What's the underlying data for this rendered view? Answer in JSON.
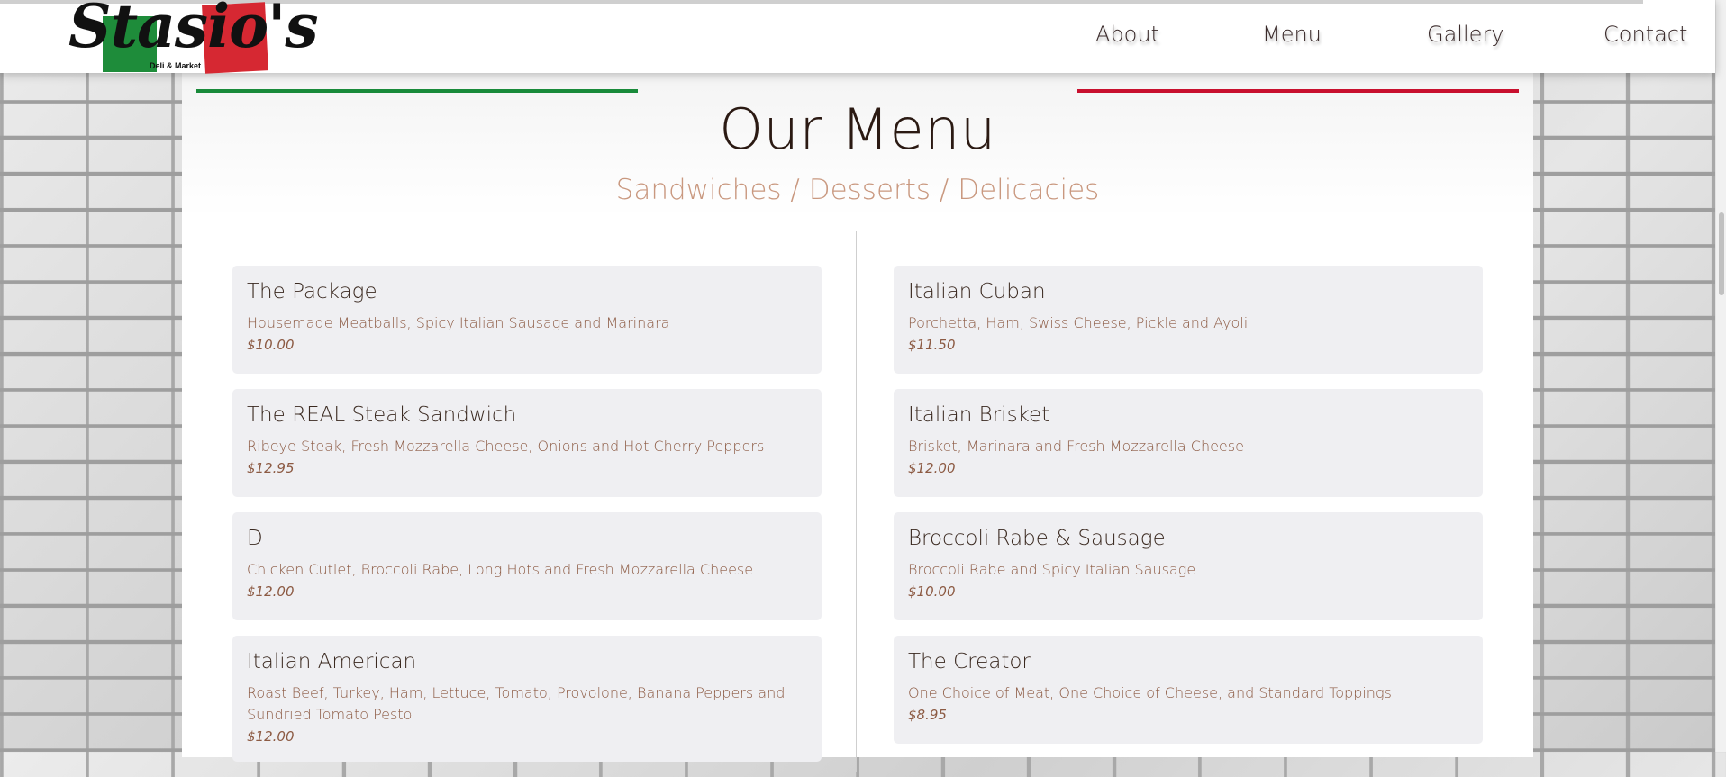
{
  "brand": {
    "logo_text": "Stasio's",
    "logo_subtext": "Deli & Market"
  },
  "nav": {
    "items": [
      "About",
      "Menu",
      "Gallery",
      "Contact"
    ]
  },
  "menu": {
    "title": "Our Menu",
    "subtitle": "Sandwiches / Desserts / Delicacies",
    "left": [
      {
        "name": "The Package",
        "desc": "Housemade Meatballs, Spicy Italian Sausage and Marinara",
        "price": "$10.00"
      },
      {
        "name": "The REAL Steak Sandwich",
        "desc": "Ribeye Steak, Fresh Mozzarella Cheese, Onions and Hot Cherry Peppers",
        "price": "$12.95"
      },
      {
        "name": "D",
        "desc": "Chicken Cutlet, Broccoli Rabe, Long Hots and Fresh Mozzarella Cheese",
        "price": "$12.00"
      },
      {
        "name": "Italian American",
        "desc": "Roast Beef, Turkey, Ham, Lettuce, Tomato, Provolone, Banana Peppers and Sundried Tomato Pesto",
        "price": "$12.00"
      }
    ],
    "right": [
      {
        "name": "Italian Cuban",
        "desc": "Porchetta, Ham, Swiss Cheese, Pickle and Ayoli",
        "price": "$11.50"
      },
      {
        "name": "Italian Brisket",
        "desc": "Brisket, Marinara and Fresh Mozzarella Cheese",
        "price": "$12.00"
      },
      {
        "name": "Broccoli Rabe & Sausage",
        "desc": "Broccoli Rabe and Spicy Italian Sausage",
        "price": "$10.00"
      },
      {
        "name": "The Creator",
        "desc": "One Choice of Meat, One Choice of Cheese, and Standard Toppings",
        "price": "$8.95"
      }
    ]
  },
  "colors": {
    "accent_green": "#198a3a",
    "accent_red": "#c8102e",
    "title_brown": "#2b1a13",
    "subtitle_tan": "#c9987f",
    "card_bg": "#efeff2"
  }
}
